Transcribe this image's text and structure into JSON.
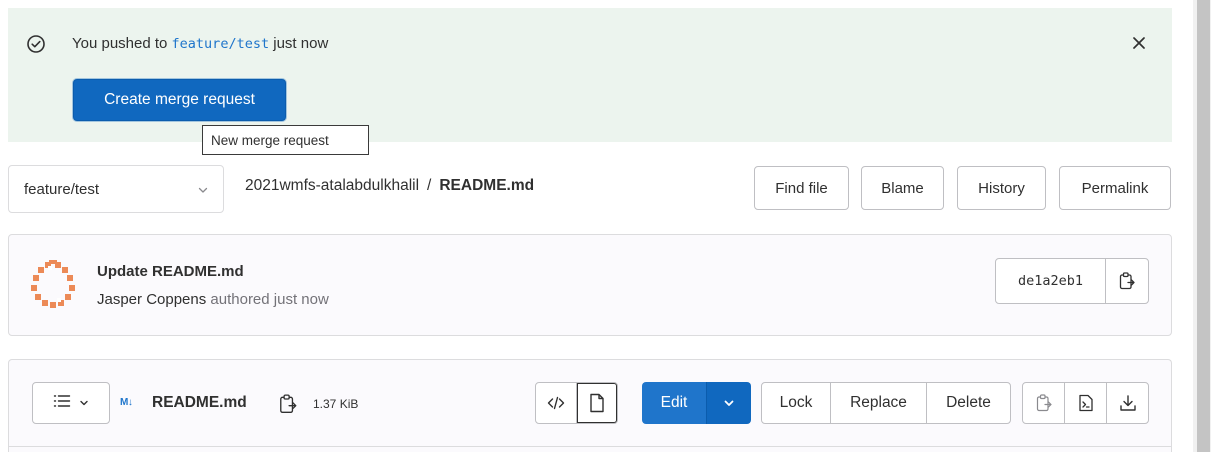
{
  "alert": {
    "prefix": "You pushed to ",
    "branch": "feature/test",
    "suffix": " just now",
    "button_label": "Create merge request",
    "tooltip": "New merge request"
  },
  "breadcrumb": {
    "branch_selected": "feature/test",
    "project": "2021wmfs-atalabdulkhalil",
    "separator": "/",
    "file": "README.md"
  },
  "tree_actions": {
    "find_file": "Find file",
    "blame": "Blame",
    "history": "History",
    "permalink": "Permalink"
  },
  "commit": {
    "title": "Update README.md",
    "author": "Jasper Coppens",
    "authored": " authored just now",
    "sha": "de1a2eb1"
  },
  "file_header": {
    "format_badge": "M↓",
    "name": "README.md",
    "size": "1.37 KiB",
    "edit_label": "Edit",
    "lock_label": "Lock",
    "replace_label": "Replace",
    "delete_label": "Delete"
  },
  "icons": {
    "alert": "check-circle-icon",
    "close": "close-icon",
    "copy": "copy-icon",
    "code": "code-icon",
    "document": "document-icon",
    "list": "list-icon",
    "raw": "raw-file-icon",
    "download": "download-icon"
  },
  "colors": {
    "alert_bg": "#ecf4ee",
    "primary": "#1f75cb",
    "primary_dark": "#1068bf",
    "text": "#303030",
    "muted": "#737278"
  }
}
